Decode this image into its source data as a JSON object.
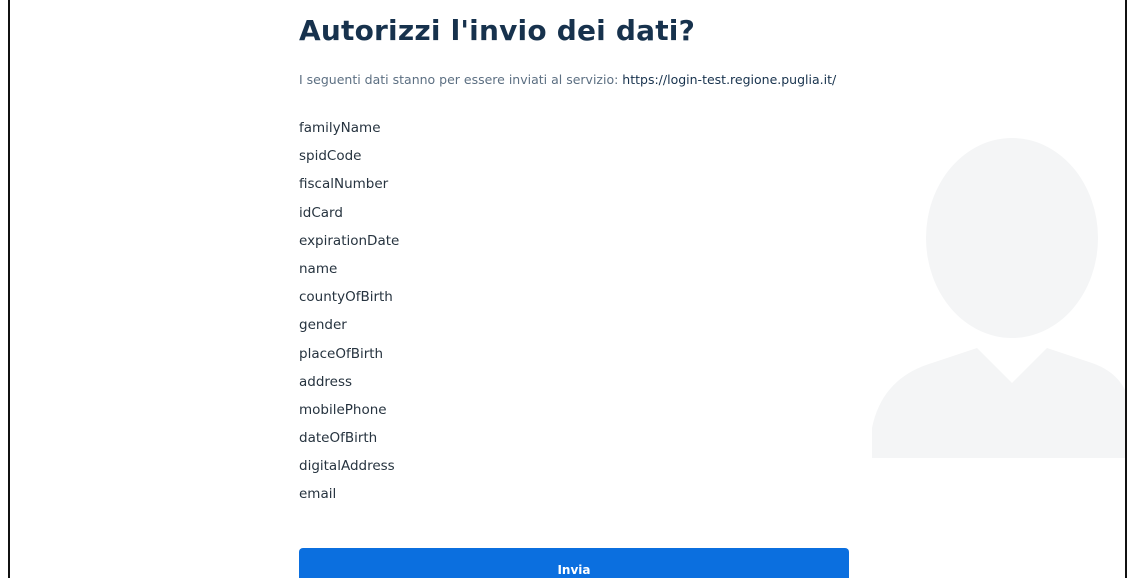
{
  "heading": "Autorizzi l'invio dei dati?",
  "subtitle": {
    "text": "I seguenti dati stanno per essere inviati al servizio: ",
    "url": "https://login-test.regione.puglia.it/"
  },
  "attributes": [
    "familyName",
    "spidCode",
    "fiscalNumber",
    "idCard",
    "expirationDate",
    "name",
    "countyOfBirth",
    "gender",
    "placeOfBirth",
    "address",
    "mobilePhone",
    "dateOfBirth",
    "digitalAddress",
    "email"
  ],
  "submit_label": "Invia",
  "colors": {
    "heading": "#17324d",
    "text": "#26333f",
    "muted": "#5c6f82",
    "button": "#0b6fdf",
    "avatar": "#f4f5f6"
  },
  "icons": {
    "background": "user-silhouette-icon"
  }
}
